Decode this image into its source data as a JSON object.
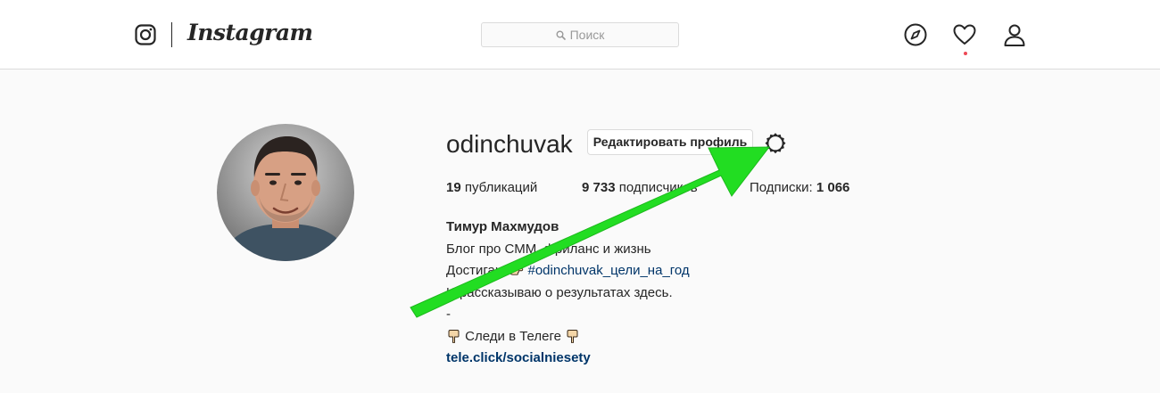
{
  "header": {
    "logo_wordmark": "Instagram",
    "search": {
      "placeholder": "Поиск"
    },
    "nav_icons": [
      "compass-icon",
      "heart-icon",
      "person-icon"
    ],
    "activity_dot_color": "#ed4956"
  },
  "profile": {
    "username": "odinchuvak",
    "edit_profile_label": "Редактировать профиль",
    "settings_icon": "gear-icon",
    "stats": {
      "posts_count": "19",
      "posts_label": "публикаций",
      "followers_count": "9 733",
      "followers_label": "подписчиков",
      "following_label": "Подписки:",
      "following_count": "1 066"
    },
    "bio": {
      "name": "Тимур Махмудов",
      "line1": "Блог про СММ, фриланс и жизнь",
      "line2_prefix": "Достигаю",
      "line2_hashtag": "#odinchuvak_цели_на_год",
      "line3": "И рассказываю о результатах здесь.",
      "line4": "-",
      "line5": "Следи в Телеге",
      "link": "tele.click/socialniesety"
    }
  },
  "annotation": {
    "arrow_color": "#22dd22",
    "points_to": "gear-icon"
  }
}
